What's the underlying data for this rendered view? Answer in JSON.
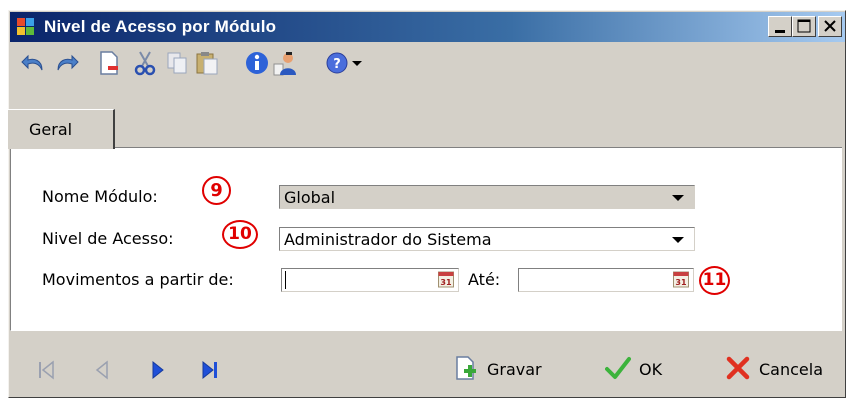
{
  "window": {
    "title": "Nivel de Acesso por Módulo",
    "controls": [
      "minimize",
      "maximize",
      "close"
    ]
  },
  "toolbar": {
    "items": [
      "undo-icon",
      "redo-icon",
      "new-doc-icon",
      "cut-icon",
      "copy-icon",
      "paste-icon",
      "info-icon",
      "user-icon",
      "help-icon",
      "dropdown-arrow-icon"
    ]
  },
  "tabs": [
    {
      "label": "Geral",
      "selected": true
    }
  ],
  "form": {
    "nome_modulo": {
      "label": "Nome Módulo:",
      "value": "Global",
      "badge": "9"
    },
    "nivel_acesso": {
      "label": "Nivel de Acesso:",
      "value": "Administrador do Sistema",
      "badge": "10"
    },
    "movimentos": {
      "label": "Movimentos a partir de:",
      "from_value": "",
      "ate_label": "Até:",
      "to_value": "",
      "badge": "11"
    }
  },
  "bottom_bar": {
    "nav": [
      "first-record-icon",
      "previous-record-icon",
      "next-record-icon",
      "last-record-icon"
    ],
    "gravar_label": "Gravar",
    "ok_label": "OK",
    "cancela_label": "Cancela"
  },
  "colors": {
    "title_gradient_start": "#0a246a",
    "title_gradient_end": "#a6caf0",
    "face": "#d4d0c8",
    "badge_red": "#e00000",
    "nav_blue": "#1f4fd8"
  }
}
